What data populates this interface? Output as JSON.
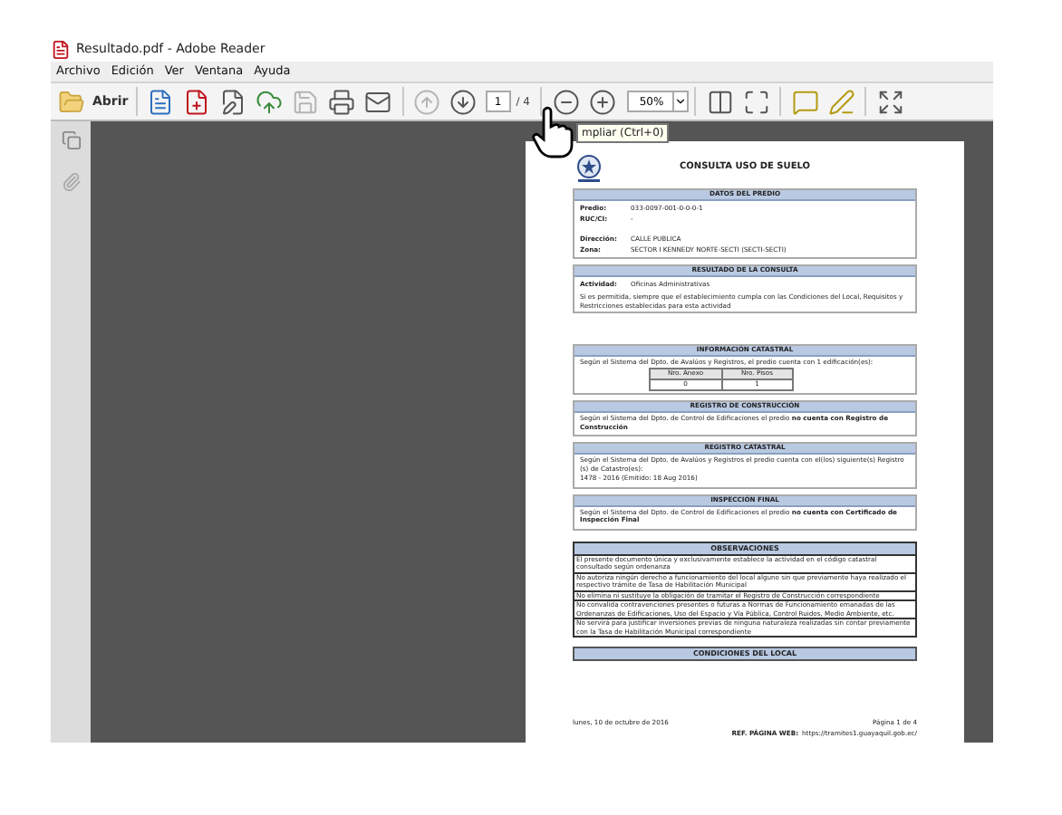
{
  "window": {
    "title": "Resultado.pdf - Adobe Reader"
  },
  "menu": [
    "Archivo",
    "Edición",
    "Ver",
    "Ventana",
    "Ayuda"
  ],
  "toolbar": {
    "open_label": "Abrir",
    "page": "1",
    "page_total": "/ 4",
    "zoom": "50%"
  },
  "tooltip": "mpliar (Ctrl+0)",
  "document": {
    "title": "CONSULTA USO DE SUELO",
    "sections": [
      {
        "kind": "fields",
        "heading": "DATOS DEL PREDIO",
        "fields": [
          {
            "label": "Predio:",
            "value": "033-0097-001-0-0-0-1"
          },
          {
            "label": "RUC/CI:",
            "value": "-"
          },
          {
            "label": "Dirección:",
            "value": "CALLE PUBLICA"
          },
          {
            "label": "Zona:",
            "value": "SECTOR I KENNEDY NORTE-SECTI (SECTI-SECTI)"
          }
        ]
      },
      {
        "kind": "fields",
        "heading": "RESULTADO DE LA CONSULTA",
        "fields": [
          {
            "label": "Actividad:",
            "value": "Oficinas Administrativas"
          }
        ],
        "note": "Si es permitida, siempre que el establecimiento cumpla con las Condiciones del Local, Requisitos y Restricciones establecidas para esta actividad"
      },
      {
        "kind": "table",
        "heading": "INFORMACIÓN CATASTRAL",
        "text": "Según el Sistema del Dpto. de Avalúos y Registros, el predio cuenta con 1 edificación(es):",
        "columns": [
          "Nro. Anexo",
          "Nro. Pisos"
        ],
        "row": [
          "0",
          "1"
        ]
      },
      {
        "kind": "text",
        "heading": "REGISTRO DE CONSTRUCCIÓN",
        "paragraphs": [
          "Según el Sistema del Dpto. de Control de Edificaciones el predio **no cuenta con Registro de Construcción**"
        ]
      },
      {
        "kind": "text",
        "heading": "REGISTRO CATASTRAL",
        "paragraphs": [
          "Según el Sistema del Dpto. de Avalúos y Registros el predio cuenta con el(los) siguiente(s) Registro (s) de Catastro(es):",
          "1478 - 2016 (Emitido: 18 Aug 2016)"
        ]
      },
      {
        "kind": "text",
        "heading": "INSPECCIÓN FINAL",
        "paragraphs": [
          "Según el Sistema del Dpto. de Control de Edificaciones el predio **no cuenta con Certificado de Inspección Final**"
        ]
      },
      {
        "kind": "list",
        "heading": "OBSERVACIONES",
        "items": [
          "El presente documento única y exclusivamente establece la actividad en el código catastral consultado según ordenanza",
          "No autoriza ningún derecho a funcionamiento del local alguno sin que previamente haya realizado el respectivo trámite de Tasa de Habilitación Municipal",
          "No elimina ni sustituye la obligación de tramitar el Registro de Construcción correspondiente",
          "No convalida contravenciones presentes o futuras a Normas de Funcionamiento emanadas de las Ordenanzas de Edificaciones, Uso del Espacio y Vía Pública, Control Ruidos, Medio Ambiente, etc.",
          "No servirá para justificar inversiones previas de ninguna naturaleza realizadas sin contar previamente con la Tasa de Habilitación Municipal correspondiente"
        ]
      },
      {
        "kind": "heading",
        "heading": "CONDICIONES DEL LOCAL"
      }
    ],
    "footer": {
      "date": "lunes, 10 de octubre de 2016",
      "page": "Página 1 de 4",
      "web_label": "REF. PÁGINA WEB:",
      "web": "https://tramites1.guayaquil.gob.ec/"
    }
  }
}
